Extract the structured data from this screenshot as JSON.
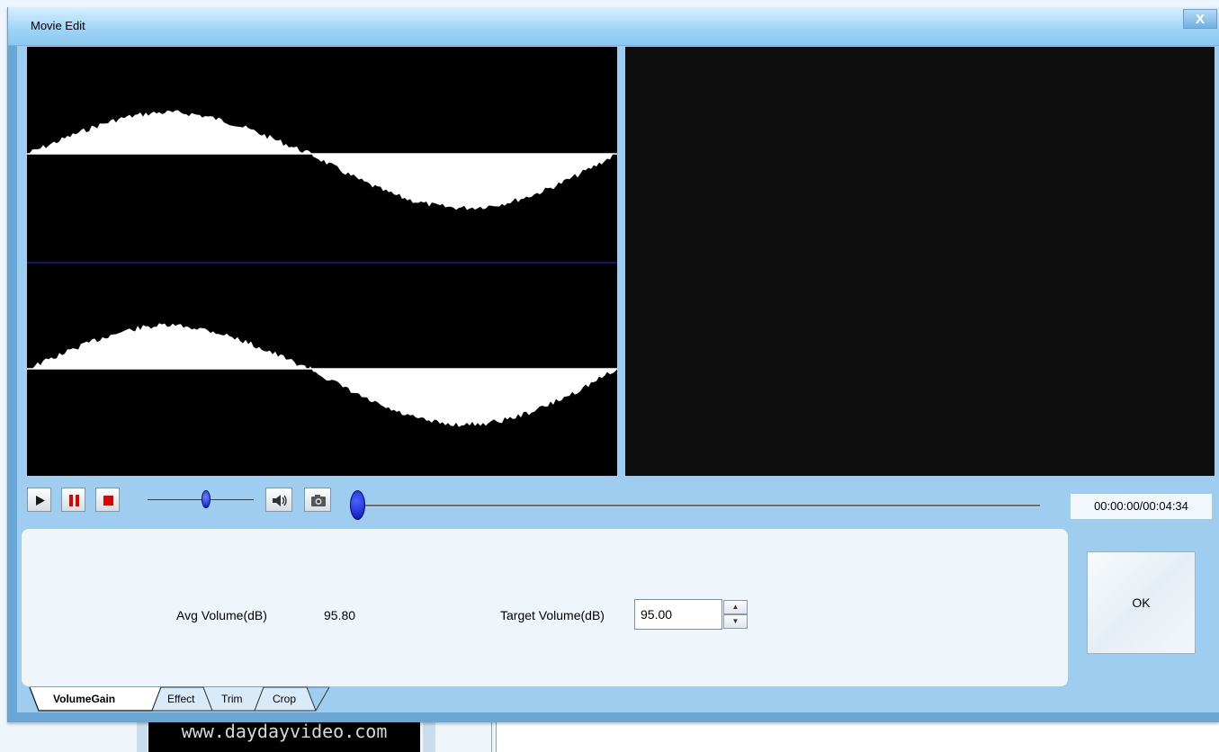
{
  "window": {
    "title": "Movie Edit",
    "close_glyph": "X"
  },
  "transport": {
    "time": "00:00:00/00:04:34",
    "volume_level": 0.55,
    "seek_position": 0.0
  },
  "volume_gain": {
    "avg_label": "Avg Volume(dB)",
    "avg_value": "95.80",
    "target_label": "Target Volume(dB)",
    "target_value": "95.00"
  },
  "ok_label": "OK",
  "tabs": [
    {
      "label": "VolumeGain",
      "active": true
    },
    {
      "label": "Effect",
      "active": false
    },
    {
      "label": "Trim",
      "active": false
    },
    {
      "label": "Crop",
      "active": false
    }
  ],
  "background_app": {
    "logo_text": "www.daydayvideo.com"
  },
  "icons": {
    "play": "play-icon",
    "pause": "pause-icon",
    "stop": "stop-icon",
    "speaker": "speaker-icon",
    "camera": "camera-icon"
  },
  "colors": {
    "dialog_bg": "#9fcdef",
    "waveform": "#ffffff",
    "channel_divider": "#1b1ba0",
    "transport_red": "#e00000",
    "knob_blue": "#0a1fc0"
  }
}
